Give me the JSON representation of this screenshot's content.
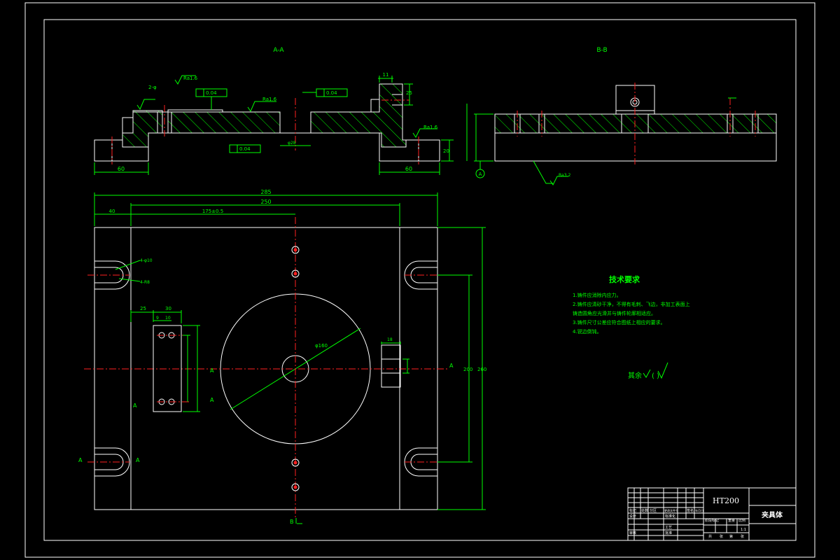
{
  "views": {
    "section_aa_label": "A-A",
    "section_bb_label": "B-B"
  },
  "dimensions": {
    "d_60_left": "60",
    "d_60_right": "60",
    "d_285": "285",
    "d_250": "250",
    "d_40": "40",
    "d_175": "175±0.5",
    "d_200": "200",
    "d_260": "260",
    "d_11": "11",
    "d_25": "25",
    "d_20": "20",
    "d_30": "30",
    "d_9": "9",
    "d_10": "10",
    "d_18": "18",
    "d_4phi10": "4-φ10",
    "d_4r8": "4-R8",
    "d_phi160": "φ160"
  },
  "tolerances": {
    "tol_1": "0.04",
    "tol_2": "0.04",
    "tol_3": "0.04"
  },
  "datum": {
    "a": "A"
  },
  "roughness": {
    "ra16_a": "Ra1.6",
    "ra16_b": "Ra1.6",
    "ra16_c": "Ra1.6",
    "ra125": "Ra3.2"
  },
  "section_marks": {
    "a_left_1": "A",
    "a_right_1": "A",
    "a_left_2": "A",
    "a_right_2": "A",
    "a_left_3": "A",
    "a_right_3": "A",
    "b_bottom": "B"
  },
  "tech_requirements": {
    "title": "技术要求",
    "lines": [
      "1.铸件应消除内应力。",
      "2.铸件应清砂干净，不得有毛刺、飞边，非加工表面上",
      "  铸造圆角应光滑并与铸件轮廓相适应。",
      "3.铸件尺寸公差应符合图纸上相应的要求。",
      "4.锐边倒钝。"
    ],
    "other_roughness": "其余",
    "roughness_paren": "( )"
  },
  "title_block": {
    "material": "HT200",
    "part_name": "夹具体",
    "scale": "1:1",
    "r1": [
      "标记",
      "处数",
      "分区",
      "更改文件号",
      "签名",
      "年月日"
    ],
    "r2": [
      "设计",
      "标准化"
    ],
    "r3": [
      "审核",
      "工艺"
    ],
    "r4": [
      "批准"
    ],
    "r5": [
      "阶段标记",
      "重量",
      "比例"
    ],
    "r6": [
      "共",
      "张",
      "第",
      "张"
    ]
  }
}
